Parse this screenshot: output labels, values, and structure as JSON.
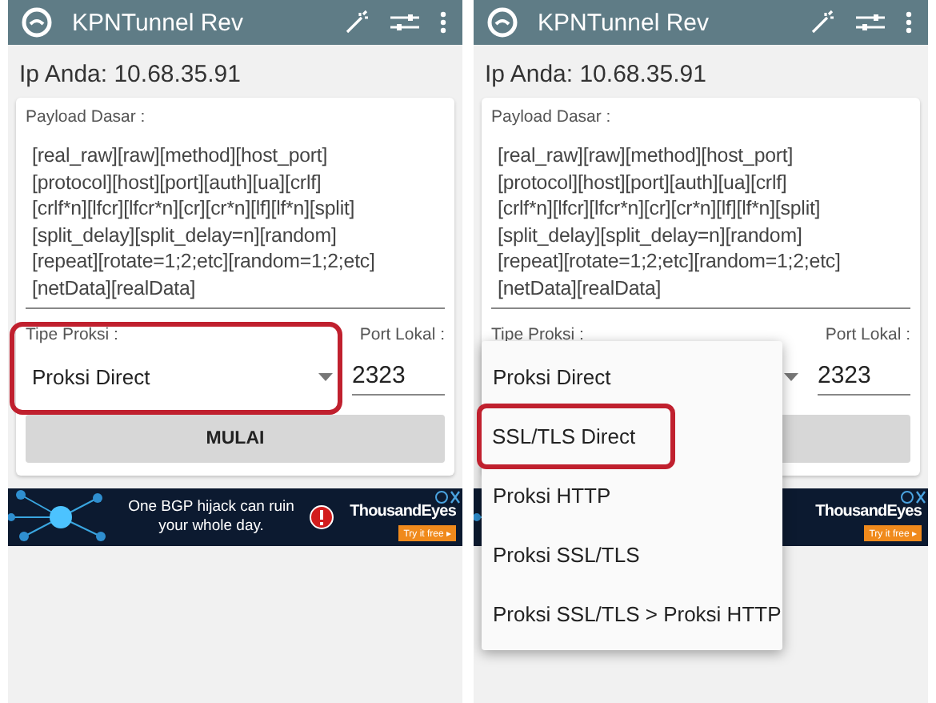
{
  "screens": [
    {
      "title": "KPNTunnel Rev",
      "ip": "Ip Anda: 10.68.35.91",
      "payload_label": "Payload Dasar :",
      "payload": "[real_raw][raw][method][host_port]\n[protocol][host][port][auth][ua][crlf]\n[crlf*n][lfcr][lfcr*n][cr][cr*n][lf][lf*n][split]\n[split_delay][split_delay=n][random]\n[repeat][rotate=1;2;etc][random=1;2;etc]\n[netData][realData]",
      "proxy_label": "Tipe Proksi :",
      "proxy_value": "Proksi Direct",
      "proxy_highlighted": true,
      "port_label": "Port Lokal :",
      "port": "2323",
      "start_button": "MULAI",
      "ad": {
        "headline": "One BGP hijack can ruin your whole day.",
        "brand": "ThousandEyes",
        "cta": "Try it free ▸"
      }
    },
    {
      "title": "KPNTunnel Rev",
      "ip": "Ip Anda: 10.68.35.91",
      "payload_label": "Payload Dasar :",
      "payload": "[real_raw][raw][method][host_port]\n[protocol][host][port][auth][ua][crlf]\n[crlf*n][lfcr][lfcr*n][cr][cr*n][lf][lf*n][split]\n[split_delay][split_delay=n][random]\n[repeat][rotate=1;2;etc][random=1;2;etc]\n[netData][realData]",
      "proxy_label": "Tipe Proksi :",
      "port_label": "Port Lokal :",
      "port": "2323",
      "ad": {
        "brand": "ThousandEyes",
        "cta": "Try it free ▸"
      },
      "menu": {
        "items": [
          {
            "label": "Proksi Direct",
            "highlighted": false
          },
          {
            "label": "SSL/TLS Direct",
            "highlighted": true
          },
          {
            "label": "Proksi HTTP",
            "highlighted": false
          },
          {
            "label": "Proksi SSL/TLS",
            "highlighted": false
          },
          {
            "label": "Proksi SSL/TLS > Proksi HTTP",
            "highlighted": false
          }
        ]
      }
    }
  ]
}
